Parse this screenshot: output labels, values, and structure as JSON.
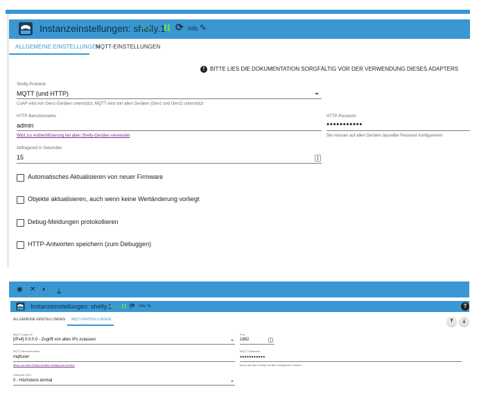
{
  "colors": {
    "header": "#3a97d2",
    "active_tab": "#3a97d2",
    "link": "#7a2a8a",
    "status_green": "#66c36b"
  },
  "top_panel": {
    "header": {
      "title": "Instanzeinstellungen: shelly.1",
      "version": "v8.4.1",
      "icons": [
        "adapter-logo",
        "pause-icon",
        "reload-icon",
        "pencil-icon"
      ],
      "info_label": "info"
    },
    "tabs": [
      "ALLGEMEINE EINSTELLUNGEN",
      "MQTT-EINSTELLUNGEN"
    ],
    "active_tab": "ALLGEMEINE EINSTELLUNGEN",
    "warning": "BITTE LIES DIE DOKUMENTATION SORGFÄLTIG VOR DER VERWENDUNG DIESES ADAPTERS",
    "protocol": {
      "label": "Shelly-Protokoll",
      "value": "MQTT (und HTTP)",
      "hint": "CoAP wird von Gen1-Geräten unterstützt, MQTT wird von allen Geräten (Gen1 und Gen2) unterstützt"
    },
    "http_user": {
      "label": "HTTP-Benutzername",
      "value": "admin",
      "hint": "Wird zur Authentifizierung bei allen Shelly-Geräten verwendet"
    },
    "http_password": {
      "label": "HTTP-Passwort",
      "value": "●●●●●●●●●●●",
      "hint": "Sie müssen auf allen Geräten dasselbe Passwort konfigurieren"
    },
    "poll": {
      "label": "Abfragezeit in Sekunden",
      "value": "15"
    },
    "checkboxes": [
      {
        "label": "Automatisches Aktualisieren von neuer Firmware",
        "checked": false
      },
      {
        "label": "Objekte aktualisieren, auch wenn keine Wertänderung vorliegt",
        "checked": false
      },
      {
        "label": "Debug-Meldungen protokollieren",
        "checked": false
      },
      {
        "label": "HTTP-Antworten speichern (zum Debuggen)",
        "checked": false
      }
    ]
  },
  "bottom_panel": {
    "toolbar_icons": [
      "eye-icon",
      "wrench-icon",
      "contrast-icon",
      "plug-icon"
    ],
    "header": {
      "title": "Instanzeinstellungen: shelly.1",
      "version": "v8.4.1",
      "info_label": "info"
    },
    "tabs": [
      "ALLGEMEINE EINSTELLUNGEN",
      "MQTT-EINSTELLUNGEN"
    ],
    "active_tab": "MQTT-EINSTELLUNGEN",
    "listen_ip": {
      "label": "MQTT-Listen-IP",
      "value": "[IPv4] 0.0.0.0 - Zugriff von allen IPs zulassen"
    },
    "port": {
      "label": "Port",
      "value": "1882"
    },
    "mqtt_user": {
      "label": "MQTT-Benutzername",
      "value": "mqttuser",
      "hint": "Muss auf allen Shelly-Geräten konfiguriert werden"
    },
    "mqtt_password": {
      "label": "MQTT-Passwort",
      "value": "●●●●●●●●●●●",
      "hint": "Muss auf allen Shelly-Geräten konfiguriert werden"
    },
    "qos": {
      "label": "Standard-QoS",
      "value": "0 - Höchstens einmal"
    }
  }
}
